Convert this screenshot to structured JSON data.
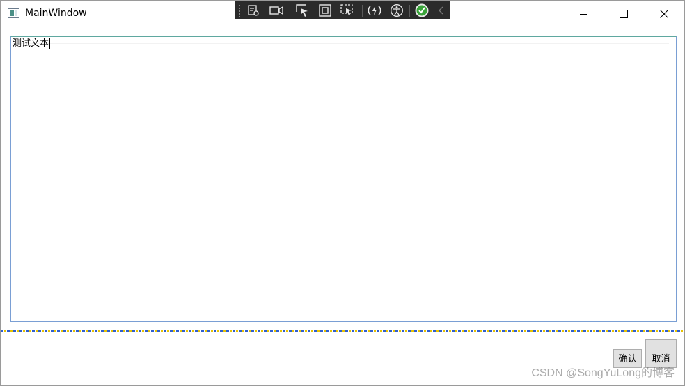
{
  "window": {
    "title": "MainWindow"
  },
  "devtools": {
    "tools": [
      "live-visual-tree-icon",
      "record-icon",
      "select-element-icon",
      "display-layout-adorners-icon",
      "track-focus-icon",
      "hot-reload-icon",
      "accessibility-icon",
      "binding-check-icon",
      "collapse-chevron-icon"
    ]
  },
  "editor": {
    "text": "测试文本"
  },
  "buttons": {
    "confirm_label": "确认",
    "cancel_label": "取消"
  },
  "watermark": {
    "text": "CSDN @SongYuLong的博客"
  },
  "colors": {
    "textbox_border": "#7a9fd4",
    "toolbar_bg": "#2b2b2b",
    "button_bg": "#e1e1e1"
  }
}
